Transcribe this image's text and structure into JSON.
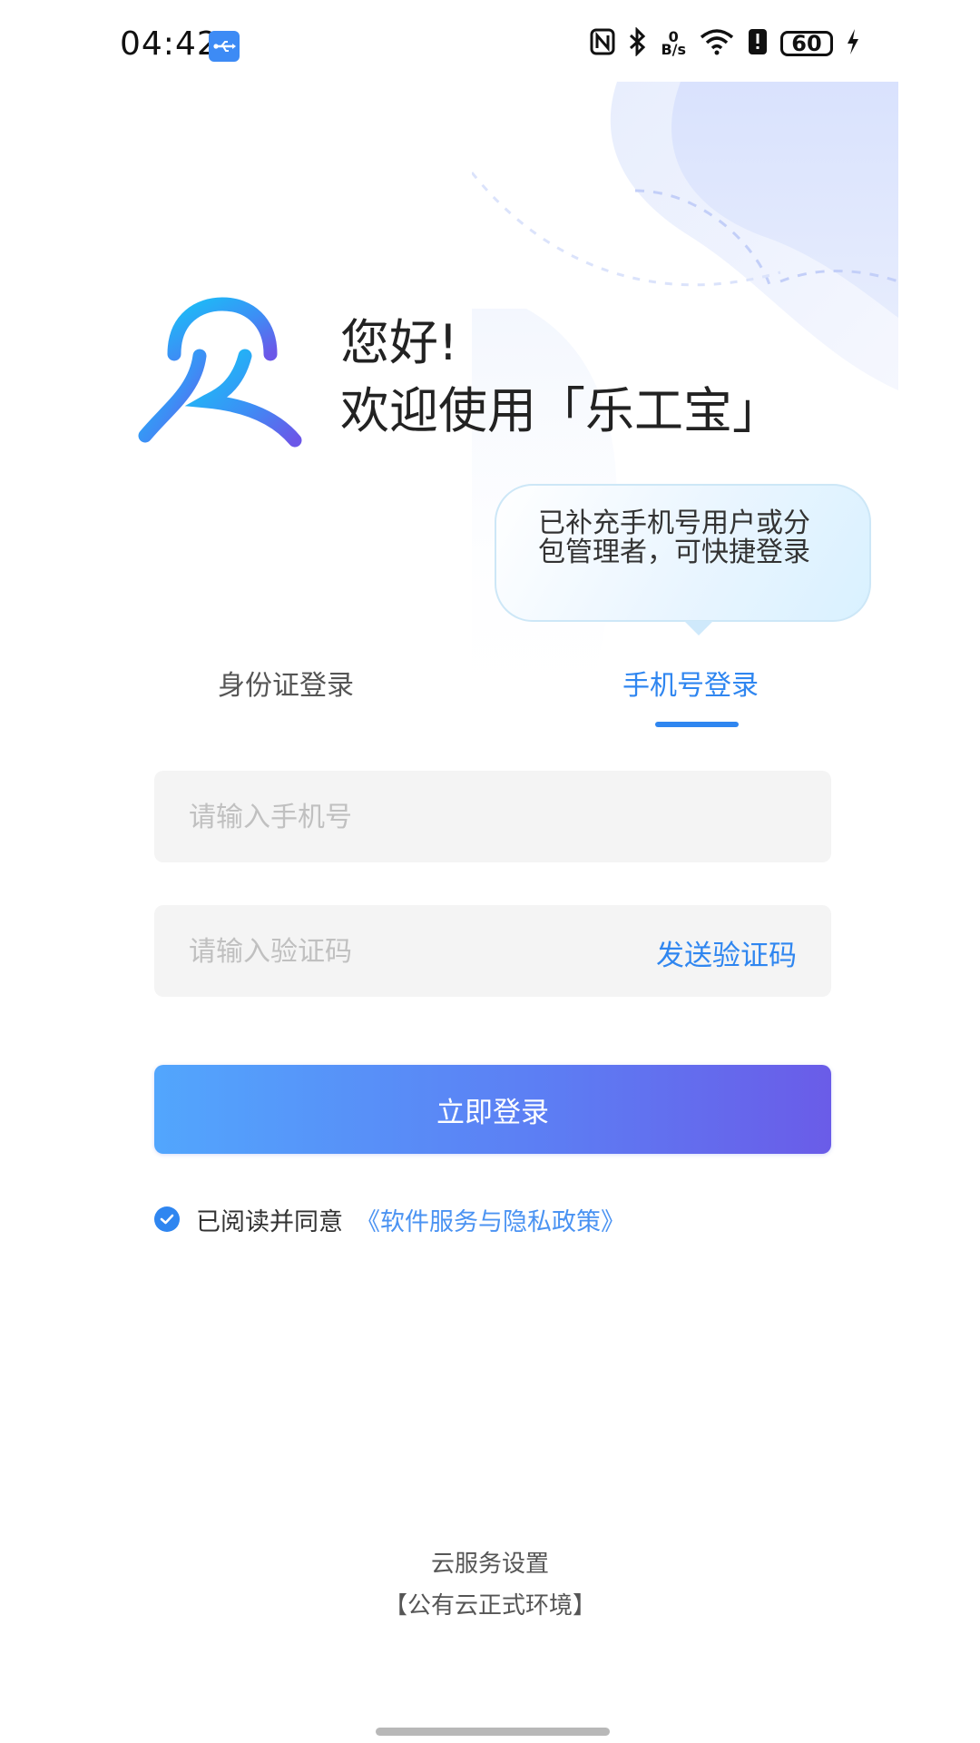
{
  "status_bar": {
    "time": "04:42",
    "usb_icon": "usb-icon",
    "net_speed_value": "0",
    "net_speed_unit": "B/s",
    "battery": "60",
    "icons": [
      "nfc-icon",
      "bluetooth-icon",
      "wifi-icon",
      "alert-icon",
      "charging-icon"
    ]
  },
  "greeting": {
    "line1": "您好!",
    "line2": "欢迎使用「乐工宝」"
  },
  "tooltip": {
    "text": "已补充手机号用户或分包管理者，可快捷登录"
  },
  "tabs": {
    "id_login": "身份证登录",
    "phone_login": "手机号登录",
    "active": "phone_login"
  },
  "form": {
    "phone_placeholder": "请输入手机号",
    "code_placeholder": "请输入验证码",
    "send_code": "发送验证码",
    "login_button": "立即登录"
  },
  "agreement": {
    "checked": true,
    "text": "已阅读并同意",
    "link": "《软件服务与隐私政策》"
  },
  "footer": {
    "cloud_settings": "云服务设置",
    "environment": "【公有云正式环境】"
  },
  "colors": {
    "primary": "#2f86f0",
    "button_start": "#52a6fd",
    "button_end": "#6a5ce8",
    "input_bg": "#f4f4f4"
  }
}
